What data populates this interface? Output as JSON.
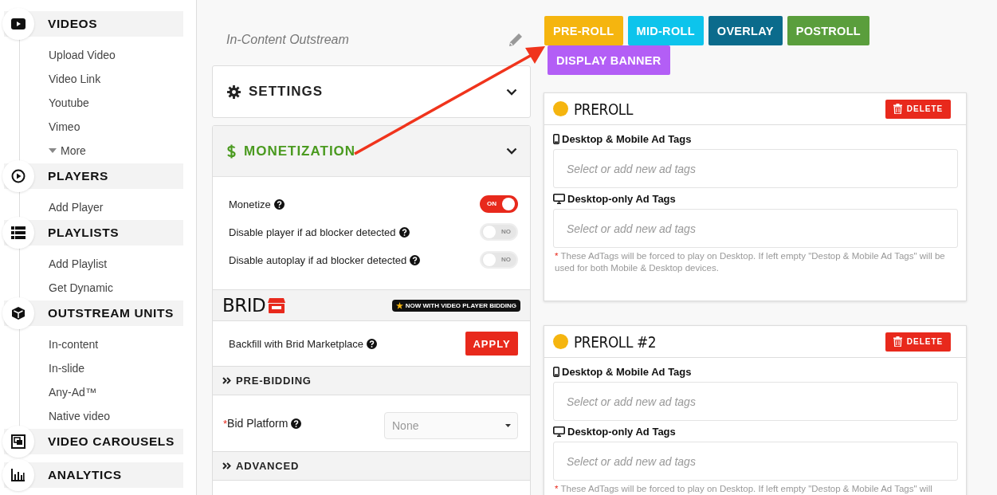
{
  "sidebar": {
    "sections": [
      {
        "title": "VIDEOS",
        "items": [
          {
            "label": "Upload Video",
            "kind": "link"
          },
          {
            "label": "Video Link",
            "kind": "link"
          },
          {
            "label": "Youtube",
            "kind": "link"
          },
          {
            "label": "Vimeo",
            "kind": "link"
          },
          {
            "label": "More",
            "kind": "more"
          }
        ]
      },
      {
        "title": "PLAYERS",
        "items": [
          {
            "label": "Add Player",
            "kind": "link"
          }
        ]
      },
      {
        "title": "PLAYLISTS",
        "items": [
          {
            "label": "Add Playlist",
            "kind": "link"
          },
          {
            "label": "Get Dynamic",
            "kind": "link"
          }
        ]
      },
      {
        "title": "OUTSTREAM UNITS",
        "items": [
          {
            "label": "In-content",
            "kind": "link"
          },
          {
            "label": "In-slide",
            "kind": "link"
          },
          {
            "label": "Any-Ad™",
            "kind": "link"
          },
          {
            "label": "Native video",
            "kind": "link"
          }
        ]
      },
      {
        "title": "VIDEO CAROUSELS"
      },
      {
        "title": "ANALYTICS"
      }
    ]
  },
  "page_title": "In-Content Outstream",
  "ad_types": [
    {
      "label": "PRE-ROLL",
      "color": "#f5b50f"
    },
    {
      "label": "MID-ROLL",
      "color": "#0dc4ec"
    },
    {
      "label": "OVERLAY",
      "color": "#0b6b8c"
    },
    {
      "label": "POSTROLL",
      "color": "#5a9e3c"
    },
    {
      "label": "DISPLAY BANNER",
      "color": "#b35ef6"
    }
  ],
  "panels": [
    {
      "title": "SETTINGS",
      "kind": "settings",
      "active": false
    },
    {
      "title": "MONETIZATION",
      "kind": "money",
      "active": true
    }
  ],
  "monetization": {
    "toggles": [
      {
        "label": "Monetize",
        "on": true,
        "text": "ON"
      },
      {
        "label": "Disable player if ad blocker detected",
        "on": false,
        "text": "NO"
      },
      {
        "label": "Disable autoplay if ad blocker detected",
        "on": false,
        "text": "NO"
      }
    ],
    "marketplace": {
      "logo": "BRID",
      "badge": "NOW WITH VIDEO PLAYER BIDDING",
      "label": "Backfill with Brid Marketplace",
      "button": "APPLY"
    },
    "sections": [
      {
        "title": "PRE-BIDDING",
        "fields": [
          {
            "label": "Bid Platform",
            "required_mark": "*",
            "value": "None"
          }
        ]
      },
      {
        "title": "ADVANCED"
      }
    ]
  },
  "cards": [
    {
      "title": "PREROLL",
      "color": "#f5b50f",
      "delete_label": "DELETE",
      "fields": [
        {
          "kind": "mobile",
          "label": "Desktop & Mobile Ad Tags",
          "placeholder": "Select or add new ad tags"
        },
        {
          "kind": "desktop",
          "label": "Desktop-only Ad Tags",
          "placeholder": "Select or add new ad tags"
        }
      ],
      "note_mark": "*",
      "note": "These AdTags will be forced to play on Desktop. If left empty \"Destop & Mobile Ad Tags\" will be used for both Mobile & Desktop devices."
    },
    {
      "title": "PREROLL #2",
      "color": "#f5b50f",
      "delete_label": "DELETE",
      "fields": [
        {
          "kind": "mobile",
          "label": "Desktop & Mobile Ad Tags",
          "placeholder": "Select or add new ad tags"
        },
        {
          "kind": "desktop",
          "label": "Desktop-only Ad Tags",
          "placeholder": "Select or add new ad tags"
        }
      ],
      "note_mark": "*",
      "note": "These AdTags will be forced to play on Desktop. If left empty \"Destop & Mobile Ad Tags\" will"
    }
  ]
}
